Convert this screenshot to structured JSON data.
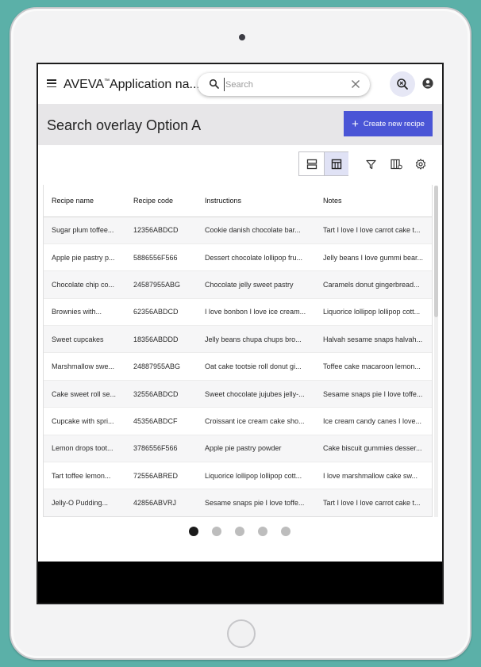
{
  "header": {
    "app_title": "AVEVA",
    "trademark": "™",
    "app_title_rest": "Application na...",
    "search_placeholder": "Search",
    "search_value": ""
  },
  "title_bar": {
    "page_title": "Search overlay Option A",
    "create_button_label": "Create new recipe"
  },
  "toolbar": {
    "icons": [
      "row-view-icon",
      "table-view-icon",
      "filter-icon",
      "column-chooser-icon",
      "settings-icon"
    ],
    "active_view": "table"
  },
  "table": {
    "columns": [
      "Recipe name",
      "Recipe code",
      "Instructions",
      "Notes"
    ],
    "rows": [
      [
        "Sugar plum toffee...",
        "12356ABDCD",
        "Cookie danish chocolate bar...",
        "Tart I love I love carrot cake t..."
      ],
      [
        "Apple pie pastry p...",
        "5886556F566",
        "Dessert chocolate lollipop fru...",
        "Jelly beans I love gummi bear..."
      ],
      [
        "Chocolate chip co...",
        "24587955ABG",
        "Chocolate jelly sweet pastry",
        "Caramels donut gingerbread..."
      ],
      [
        "Brownies with...",
        "62356ABDCD",
        "I love bonbon I love ice cream...",
        "Liquorice lollipop lollipop cott..."
      ],
      [
        "Sweet cupcakes",
        "18356ABDDD",
        "Jelly beans chupa chups bro...",
        "Halvah sesame snaps halvah..."
      ],
      [
        "Marshmallow swe...",
        "24887955ABG",
        "Oat cake tootsie roll donut gi...",
        "Toffee cake macaroon lemon..."
      ],
      [
        "Cake sweet roll se...",
        "32556ABDCD",
        "Sweet chocolate jujubes jelly-...",
        "Sesame snaps pie I love toffe..."
      ],
      [
        "Cupcake with spri...",
        "45356ABDCF",
        "Croissant ice cream cake sho...",
        "Ice cream candy canes I love..."
      ],
      [
        "Lemon drops toot...",
        "3786556F566",
        "Apple pie pastry powder",
        "Cake biscuit gummies desser..."
      ],
      [
        "Tart toffee lemon...",
        "72556ABRED",
        "Liquorice lollipop lollipop cott...",
        " I love marshmallow cake sw..."
      ],
      [
        "Jelly-O Pudding...",
        "42856ABVRJ",
        "Sesame snaps pie I love toffe...",
        "Tart I love I love carrot cake t..."
      ]
    ]
  },
  "pagination": {
    "pages": 5,
    "current_page": 1
  },
  "colors": {
    "accent": "#4a55d6",
    "title_bar_bg": "#e7e6e8",
    "background": "#5bb0a8"
  }
}
